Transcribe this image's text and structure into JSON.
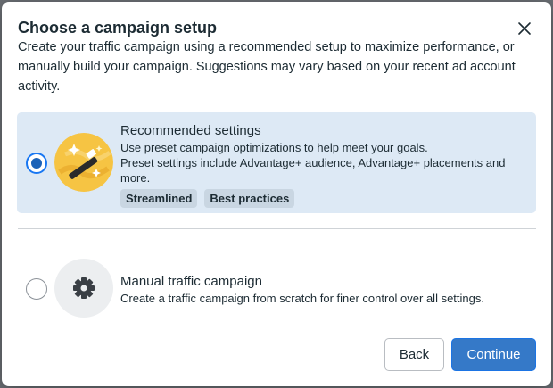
{
  "dialog": {
    "title": "Choose a campaign setup",
    "description": "Create your traffic campaign using a recommended setup to maximize performance, or manually build your campaign. Suggestions may vary based on your recent ad account activity.",
    "close_icon": "close-icon"
  },
  "options": [
    {
      "title": "Recommended settings",
      "line1": "Use preset campaign optimizations to help meet your goals.",
      "line2": "Preset settings include Advantage+ audience, Advantage+ placements and more.",
      "tags": [
        "Streamlined",
        "Best practices"
      ],
      "selected": true,
      "icon": "magic-wand-icon"
    },
    {
      "title": "Manual traffic campaign",
      "line1": "Create a traffic campaign from scratch for finer control over all settings.",
      "selected": false,
      "icon": "gear-icon"
    }
  ],
  "buttons": {
    "back": "Back",
    "continue": "Continue"
  },
  "colors": {
    "selected_bg": "#dde9f5",
    "accent": "#1b62b8",
    "primary_button": "#3579c8"
  }
}
